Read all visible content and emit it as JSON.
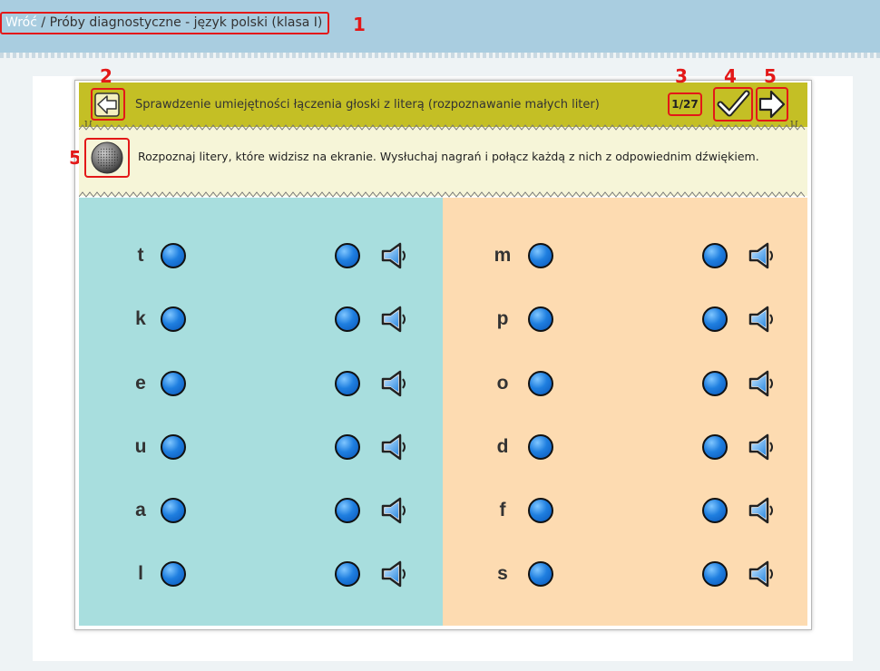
{
  "breadcrumb": {
    "back_label": "Wróć",
    "separator": " / ",
    "path": "Próby diagnostyczne - język polski (klasa I)"
  },
  "markers": {
    "m1": "1",
    "m2": "2",
    "m3": "3",
    "m4": "4",
    "m5a": "5",
    "m5b": "5"
  },
  "exercise": {
    "title": "Sprawdzenie umiejętności łączenia głoski z literą (rozpoznawanie małych liter)",
    "counter": "1/27",
    "instruction": "Rozpoznaj litery, które widzisz na ekranie. Wysłuchaj nagrań i połącz każdą z nich z odpowiednim dźwiękiem."
  },
  "icons": {
    "prev": "arrow-left-icon",
    "check": "checkmark-icon",
    "next": "arrow-right-icon",
    "audio": "speaker-grille-icon",
    "sound": "speaker-icon"
  },
  "colors": {
    "header": "#c4bf25",
    "instruction_bg": "#f6f5d8",
    "left_panel": "#a8dede",
    "right_panel": "#fddbb1",
    "annotation": "#e31818"
  },
  "left_letters": [
    "t",
    "k",
    "e",
    "u",
    "a",
    "l"
  ],
  "right_letters": [
    "m",
    "p",
    "o",
    "d",
    "f",
    "s"
  ]
}
